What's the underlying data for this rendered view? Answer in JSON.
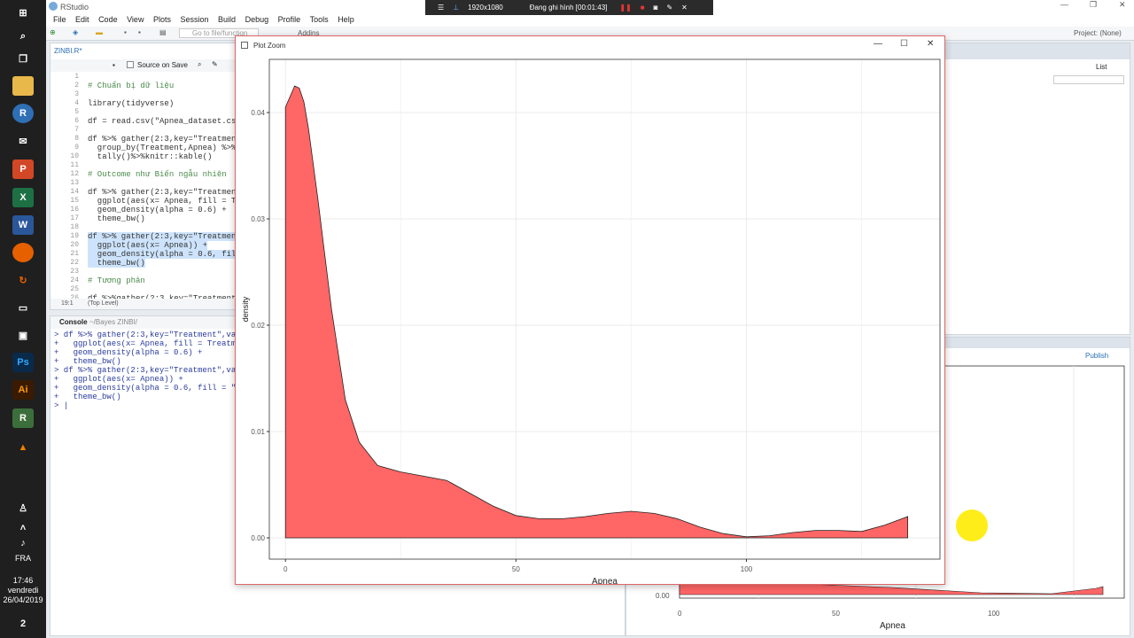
{
  "taskbar": {
    "lang": "FRA",
    "time": "17:46",
    "day": "vendredi",
    "date": "26/04/2019",
    "notif_count": "2"
  },
  "window": {
    "title": "RStudio"
  },
  "menu": [
    "File",
    "Edit",
    "Code",
    "View",
    "Plots",
    "Session",
    "Build",
    "Debug",
    "Profile",
    "Tools",
    "Help"
  ],
  "toolbar": {
    "goto_placeholder": "Go to file/function",
    "addins": "Addins",
    "project": "Project: (None)"
  },
  "recorder": {
    "resolution": "1920x1080",
    "status": "Đang ghi hình [00:01:43]"
  },
  "editor": {
    "tab": "ZINBI.R*",
    "source_on_save": "Source on Save",
    "lines": [
      {
        "n": "1",
        "t": ""
      },
      {
        "n": "2",
        "t": "# Chuẩn bị dữ liệu"
      },
      {
        "n": "3",
        "t": ""
      },
      {
        "n": "4",
        "t": "library(tidyverse)"
      },
      {
        "n": "5",
        "t": ""
      },
      {
        "n": "6",
        "t": "df = read.csv(\"Apnea_dataset.cs"
      },
      {
        "n": "7",
        "t": ""
      },
      {
        "n": "8",
        "t": "df %>% gather(2:3,key=\"Treatmen"
      },
      {
        "n": "9",
        "t": "  group_by(Treatment,Apnea) %>%"
      },
      {
        "n": "10",
        "t": "  tally()%>%knitr::kable()"
      },
      {
        "n": "11",
        "t": ""
      },
      {
        "n": "12",
        "t": "# Outcome như Biến ngẫu nhiên"
      },
      {
        "n": "13",
        "t": ""
      },
      {
        "n": "14",
        "t": "df %>% gather(2:3,key=\"Treatmen"
      },
      {
        "n": "15",
        "t": "  ggplot(aes(x= Apnea, fill = Tr"
      },
      {
        "n": "16",
        "t": "  geom_density(alpha = 0.6) +"
      },
      {
        "n": "17",
        "t": "  theme_bw()"
      },
      {
        "n": "18",
        "t": ""
      },
      {
        "n": "19",
        "t": "df %>% gather(2:3,key=\"Treatmen"
      },
      {
        "n": "20",
        "t": "  ggplot(aes(x= Apnea)) +"
      },
      {
        "n": "21",
        "t": "  geom_density(alpha = 0.6, fil"
      },
      {
        "n": "22",
        "t": "  theme_bw()"
      },
      {
        "n": "23",
        "t": ""
      },
      {
        "n": "24",
        "t": "# Tương phản"
      },
      {
        "n": "25",
        "t": ""
      },
      {
        "n": "26",
        "t": "df %>%gather(2:3,key=\"Treatment"
      }
    ],
    "status_pos": "19:1",
    "status_scope": "(Top Level)"
  },
  "console": {
    "tab": "Console",
    "path": "~/Bayes ZINBI/",
    "lines": [
      "> df %>% gather(2:3,key=\"Treatment\",va",
      "+   ggplot(aes(x= Apnea, fill = Treatm",
      "+   geom_density(alpha = 0.6) +",
      "+   theme_bw()",
      "> df %>% gather(2:3,key=\"Treatment\",va",
      "+   ggplot(aes(x= Apnea)) +",
      "+   geom_density(alpha = 0.6, fill = \"",
      "+   theme_bw()",
      "> |"
    ]
  },
  "right_pane": {
    "list_label": "List",
    "publish": "Publish"
  },
  "zoom": {
    "title": "Plot Zoom",
    "plot_colors": {
      "fill": "#ff6666",
      "stroke": "#222222",
      "grid": "#ebebeb",
      "panel_border": "#333333"
    }
  },
  "chart_data": {
    "type": "area",
    "title": "",
    "xlabel": "Apnea",
    "ylabel": "density",
    "xlim": [
      -3.5,
      142
    ],
    "ylim": [
      -0.002,
      0.045
    ],
    "x_ticks": [
      0,
      50,
      100
    ],
    "y_ticks": [
      0.0,
      0.01,
      0.02,
      0.03,
      0.04
    ],
    "x_tick_labels": [
      "0",
      "50",
      "100"
    ],
    "y_tick_labels": [
      "0.00",
      "0.01",
      "0.02",
      "0.03",
      "0.04"
    ],
    "grid": true,
    "x": [
      0,
      1,
      2,
      3,
      4,
      5,
      7,
      10,
      13,
      16,
      20,
      25,
      30,
      35,
      40,
      45,
      50,
      55,
      60,
      65,
      70,
      75,
      80,
      85,
      90,
      95,
      100,
      105,
      110,
      115,
      120,
      125,
      130,
      135
    ],
    "y": [
      0.0405,
      0.0415,
      0.0425,
      0.0423,
      0.041,
      0.0385,
      0.032,
      0.0215,
      0.013,
      0.009,
      0.0068,
      0.0062,
      0.0058,
      0.0054,
      0.0042,
      0.003,
      0.0021,
      0.0018,
      0.0018,
      0.002,
      0.0023,
      0.0025,
      0.0023,
      0.0018,
      0.001,
      0.0004,
      0.0001,
      0.0002,
      0.0005,
      0.0007,
      0.0007,
      0.0006,
      0.0012,
      0.002
    ]
  },
  "bg_plot": {
    "x_tick_labels": [
      "0",
      "50",
      "100"
    ],
    "xlabel": "Apnea",
    "y_label": "0.00"
  }
}
